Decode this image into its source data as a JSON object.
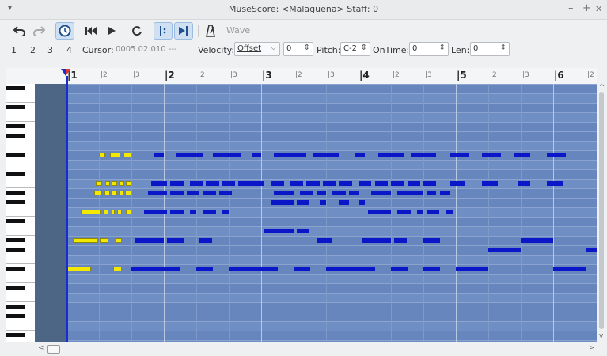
{
  "window": {
    "title": "MuseScore: <Malaguena> Staff: 0",
    "menu_glyph": "▾",
    "minimize": "–",
    "maximize": "+",
    "close": "✕"
  },
  "toolbar": {
    "undo_icon": "undo-icon",
    "redo_icon": "redo-icon",
    "wave_label": "Wave"
  },
  "info": {
    "voices": [
      "1",
      "2",
      "3",
      "4"
    ],
    "cursor_label": "Cursor:",
    "cursor_value": "0005.02.010 ---",
    "velocity_label": "Velocity:",
    "velocity_type": "Offset",
    "velocity_value": "0",
    "pitch_label": "Pitch:",
    "pitch_value": "C-2",
    "ontime_label": "OnTime:",
    "ontime_value": "0",
    "len_label": "Len:",
    "len_value": "0"
  },
  "ruler": {
    "bars": [
      "1",
      "2",
      "3",
      "4",
      "5",
      "6"
    ],
    "beats": [
      "2",
      "3"
    ]
  },
  "colors": {
    "selected_note": "#f2e800",
    "note": "#0a16c8",
    "grid": "#6f8fc4"
  },
  "notes_selected": [
    {
      "row": 7,
      "beats": [
        [
          1.0,
          1.2
        ],
        [
          1.35,
          1.65
        ],
        [
          1.75,
          2.0
        ]
      ]
    },
    {
      "row": 10,
      "beats": [
        [
          0.9,
          1.1
        ],
        [
          1.2,
          1.35
        ],
        [
          1.4,
          1.55
        ],
        [
          1.62,
          1.77
        ],
        [
          1.82,
          2.0
        ]
      ]
    },
    {
      "row": 11,
      "beats": [
        [
          0.85,
          1.1
        ],
        [
          1.18,
          1.35
        ],
        [
          1.4,
          1.55
        ],
        [
          1.6,
          1.75
        ],
        [
          1.8,
          2.0
        ]
      ]
    },
    {
      "row": 13,
      "beats": [
        [
          0.45,
          1.05
        ],
        [
          1.12,
          1.3
        ],
        [
          1.38,
          1.48
        ],
        [
          1.55,
          1.7
        ],
        [
          1.82,
          2.0
        ]
      ]
    },
    {
      "row": 16,
      "beats": [
        [
          0.2,
          0.95
        ],
        [
          1.02,
          1.3
        ],
        [
          1.5,
          1.7
        ]
      ]
    },
    {
      "row": 19,
      "beats": [
        [
          0.0,
          0.75
        ],
        [
          1.45,
          1.7
        ]
      ]
    }
  ],
  "notes_unselected": [
    {
      "row": 7,
      "beats": [
        [
          2.7,
          3.0
        ],
        [
          3.4,
          4.2
        ],
        [
          4.5,
          5.4
        ],
        [
          5.7,
          6.0
        ],
        [
          6.4,
          7.4
        ],
        [
          7.6,
          8.4
        ],
        [
          8.9,
          9.2
        ],
        [
          9.6,
          10.4
        ],
        [
          10.6,
          11.4
        ],
        [
          11.8,
          12.4
        ],
        [
          12.8,
          13.4
        ],
        [
          13.8,
          14.3
        ],
        [
          14.8,
          15.4
        ]
      ]
    },
    {
      "row": 10,
      "beats": [
        [
          2.6,
          3.1
        ],
        [
          3.2,
          3.6
        ],
        [
          3.8,
          4.2
        ],
        [
          4.3,
          4.7
        ],
        [
          4.8,
          5.2
        ],
        [
          5.3,
          5.7
        ],
        [
          5.7,
          6.1
        ],
        [
          6.3,
          6.7
        ],
        [
          6.9,
          7.3
        ],
        [
          7.4,
          7.8
        ],
        [
          7.9,
          8.3
        ],
        [
          8.4,
          8.8
        ],
        [
          9.0,
          9.4
        ],
        [
          9.5,
          9.9
        ],
        [
          10.0,
          10.4
        ],
        [
          10.5,
          10.9
        ],
        [
          11.0,
          11.4
        ],
        [
          11.8,
          12.3
        ],
        [
          12.8,
          13.3
        ],
        [
          13.9,
          14.3
        ],
        [
          14.8,
          15.3
        ]
      ]
    },
    {
      "row": 11,
      "beats": [
        [
          2.5,
          3.1
        ],
        [
          3.2,
          3.6
        ],
        [
          3.7,
          4.1
        ],
        [
          4.2,
          4.6
        ],
        [
          4.7,
          5.1
        ],
        [
          6.4,
          7.0
        ],
        [
          7.2,
          7.6
        ],
        [
          7.7,
          8.0
        ],
        [
          8.2,
          8.6
        ],
        [
          8.7,
          9.0
        ],
        [
          9.4,
          10.0
        ],
        [
          10.2,
          10.6
        ],
        [
          10.6,
          11.0
        ],
        [
          11.1,
          11.4
        ],
        [
          11.5,
          11.8
        ]
      ]
    },
    {
      "row": 12,
      "beats": [
        [
          6.3,
          7.0
        ],
        [
          7.1,
          7.5
        ],
        [
          7.8,
          8.0
        ],
        [
          8.4,
          8.7
        ],
        [
          9.0,
          9.2
        ]
      ]
    },
    {
      "row": 13,
      "beats": [
        [
          2.4,
          3.1
        ],
        [
          3.2,
          3.6
        ],
        [
          3.8,
          4.0
        ],
        [
          4.2,
          4.6
        ],
        [
          4.8,
          5.0
        ],
        [
          9.3,
          10.0
        ],
        [
          10.2,
          10.6
        ],
        [
          10.8,
          11.0
        ],
        [
          11.1,
          11.5
        ],
        [
          11.7,
          11.9
        ]
      ]
    },
    {
      "row": 15,
      "beats": [
        [
          6.1,
          7.0
        ],
        [
          7.1,
          7.5
        ]
      ]
    },
    {
      "row": 16,
      "beats": [
        [
          2.1,
          3.0
        ],
        [
          3.1,
          3.6
        ],
        [
          4.1,
          4.5
        ],
        [
          7.7,
          8.2
        ],
        [
          9.1,
          10.0
        ],
        [
          10.1,
          10.5
        ],
        [
          11.0,
          11.5
        ],
        [
          14.0,
          15.0
        ]
      ]
    },
    {
      "row": 17,
      "beats": [
        [
          13.0,
          14.0
        ],
        [
          16.0,
          16.4
        ]
      ]
    },
    {
      "row": 19,
      "beats": [
        [
          2.0,
          3.5
        ],
        [
          4.0,
          4.5
        ],
        [
          5.0,
          6.5
        ],
        [
          7.0,
          7.5
        ],
        [
          8.0,
          9.5
        ],
        [
          10.0,
          10.5
        ],
        [
          11.0,
          11.5
        ],
        [
          12.0,
          13.0
        ],
        [
          15.0,
          16.0
        ]
      ]
    }
  ]
}
